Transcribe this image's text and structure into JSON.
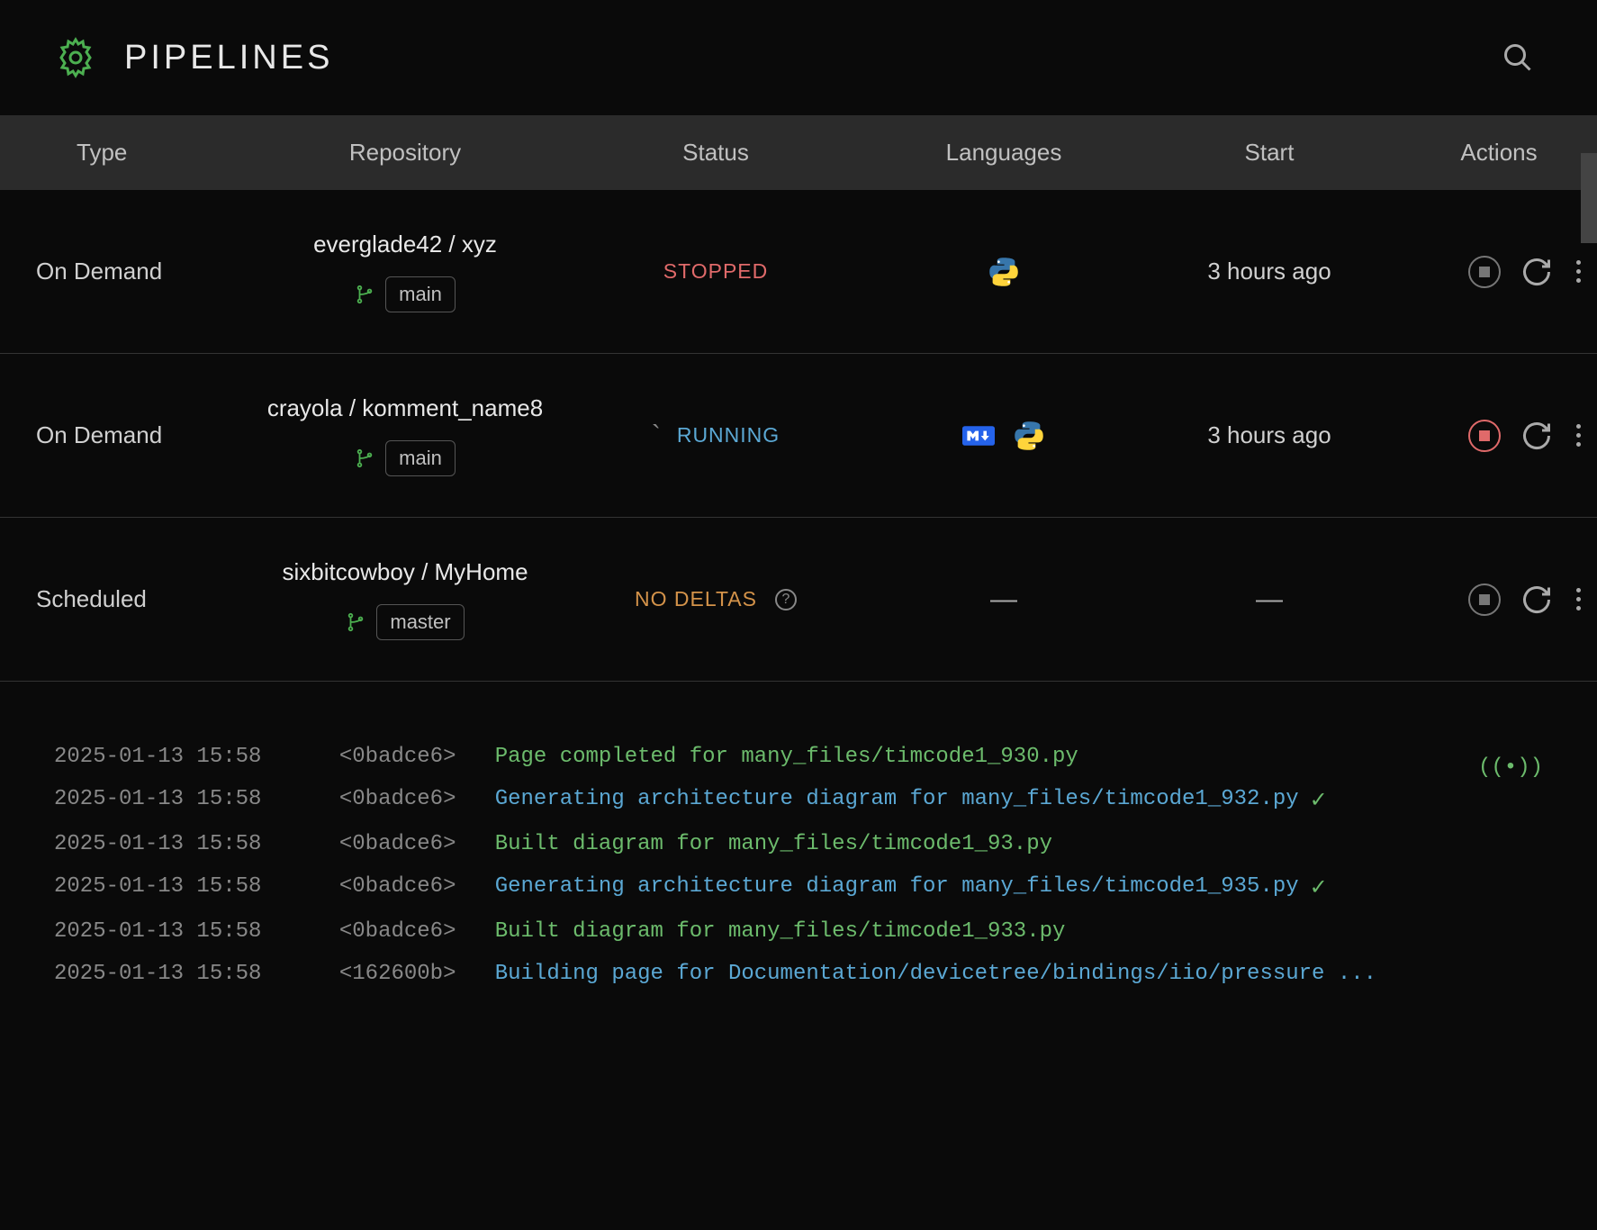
{
  "header": {
    "title": "PIPELINES"
  },
  "columns": [
    "Type",
    "Repository",
    "Status",
    "Languages",
    "Start",
    "Actions"
  ],
  "rows": [
    {
      "type": "On Demand",
      "repo": "everglade42 / xyz",
      "branch": "main",
      "status": "STOPPED",
      "statusClass": "status-stopped",
      "langs": [
        "python"
      ],
      "start": "3 hours ago",
      "stopActive": false
    },
    {
      "type": "On Demand",
      "repo": "crayola / komment_name8",
      "branch": "main",
      "status": "RUNNING",
      "statusClass": "status-running",
      "prefix": "`",
      "langs": [
        "markdown",
        "python"
      ],
      "start": "3 hours ago",
      "stopActive": true
    },
    {
      "type": "Scheduled",
      "repo": "sixbitcowboy / MyHome",
      "branch": "master",
      "status": "NO DELTAS",
      "statusClass": "status-nodeltas",
      "help": true,
      "langs": [],
      "start": "—",
      "stopActive": false
    }
  ],
  "logs": [
    {
      "ts": "2025-01-13 15:58",
      "hash": "<0badce6>",
      "msg": "Page completed for many_files/timcode1_930.py",
      "color": "green"
    },
    {
      "ts": "2025-01-13 15:58",
      "hash": "<0badce6>",
      "msg": "Generating architecture diagram for many_files/timcode1_932.py",
      "color": "blue",
      "check": true
    },
    {
      "ts": "2025-01-13 15:58",
      "hash": "<0badce6>",
      "msg": "Built diagram for many_files/timcode1_93.py",
      "color": "green"
    },
    {
      "ts": "2025-01-13 15:58",
      "hash": "<0badce6>",
      "msg": "Generating architecture diagram for many_files/timcode1_935.py",
      "color": "blue",
      "check": true
    },
    {
      "ts": "2025-01-13 15:58",
      "hash": "<0badce6>",
      "msg": "Built diagram for many_files/timcode1_933.py",
      "color": "green"
    },
    {
      "ts": "2025-01-13 15:58",
      "hash": "<162600b>",
      "msg": "Building page for Documentation/devicetree/bindings/iio/pressure ...",
      "color": "blue"
    }
  ]
}
